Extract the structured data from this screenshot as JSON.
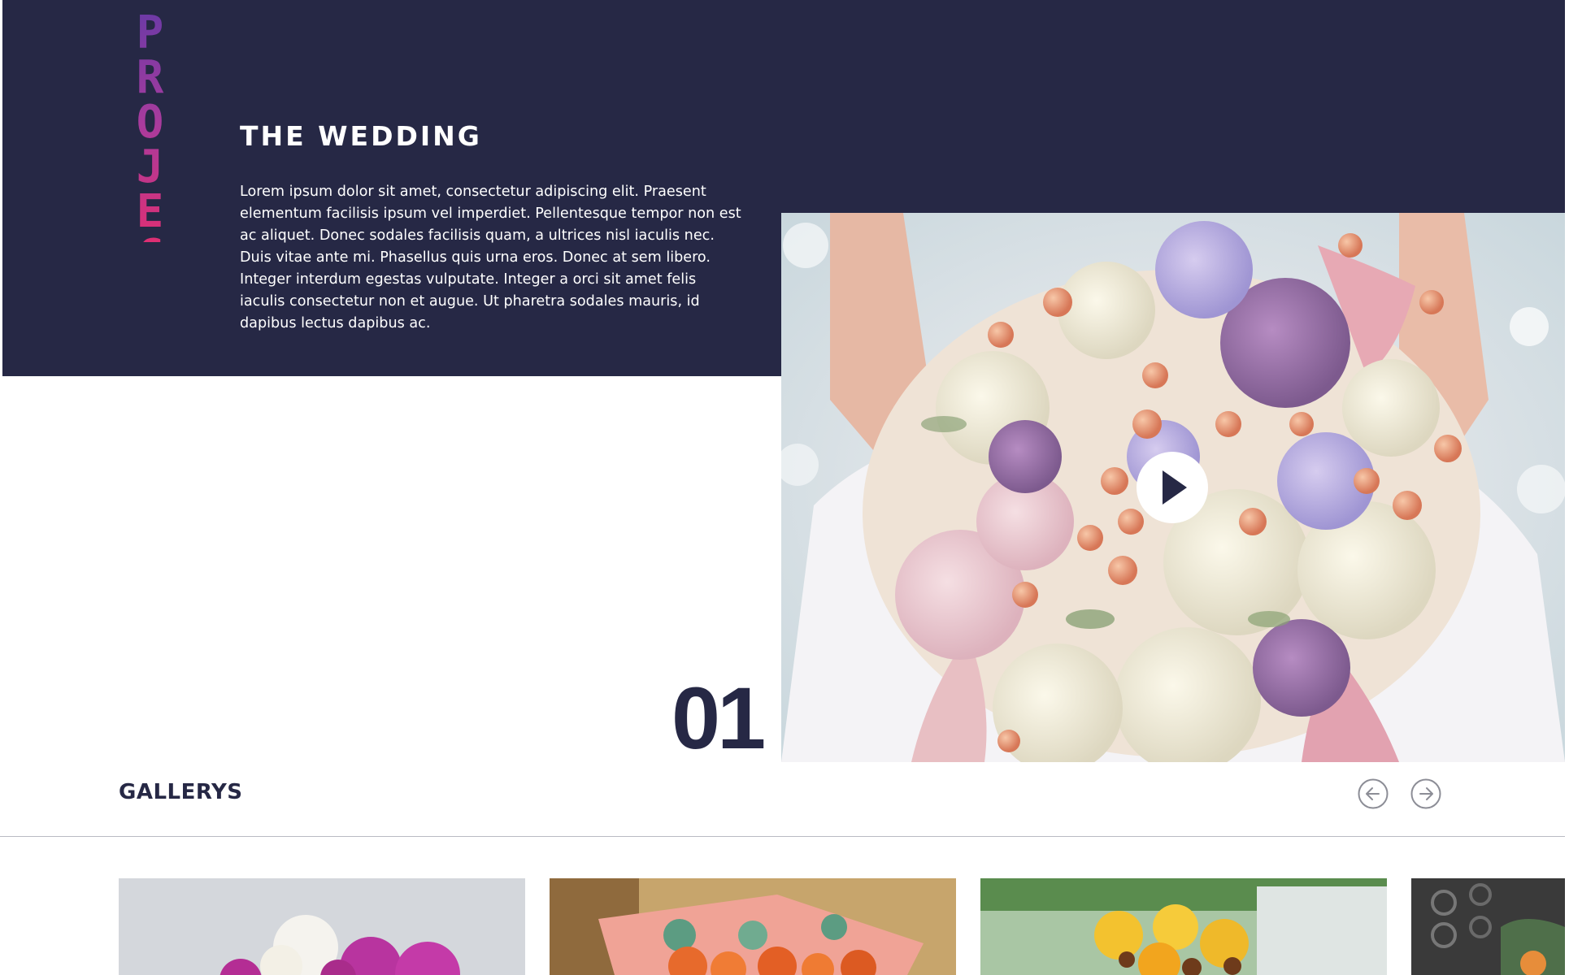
{
  "project": {
    "side_label": "PROJECT",
    "title": "THE WEDDING",
    "description": "Lorem ipsum dolor sit amet, consectetur adipiscing elit. Praesent elementum facilisis ipsum vel imperdiet. Pellentesque tempor non est ac aliquet. Donec sodales facilisis quam, a ultrices nisl iaculis nec. Duis vitae ante mi. Phasellus quis urna eros. Donec at sem libero. Integer interdum egestas vulputate. Integer a orci sit amet felis iaculis consectetur non et augue. Ut pharetra sodales mauris, id dapibus lectus dapibus ac.",
    "number": "01"
  },
  "gallery": {
    "heading": "GALLERYS"
  },
  "icons": {
    "play": "play-icon",
    "prev": "arrow-left-icon",
    "next": "arrow-right-icon"
  },
  "colors": {
    "navy": "#262845",
    "gradient_start": "#6a3aa6",
    "gradient_end": "#de2f73"
  }
}
